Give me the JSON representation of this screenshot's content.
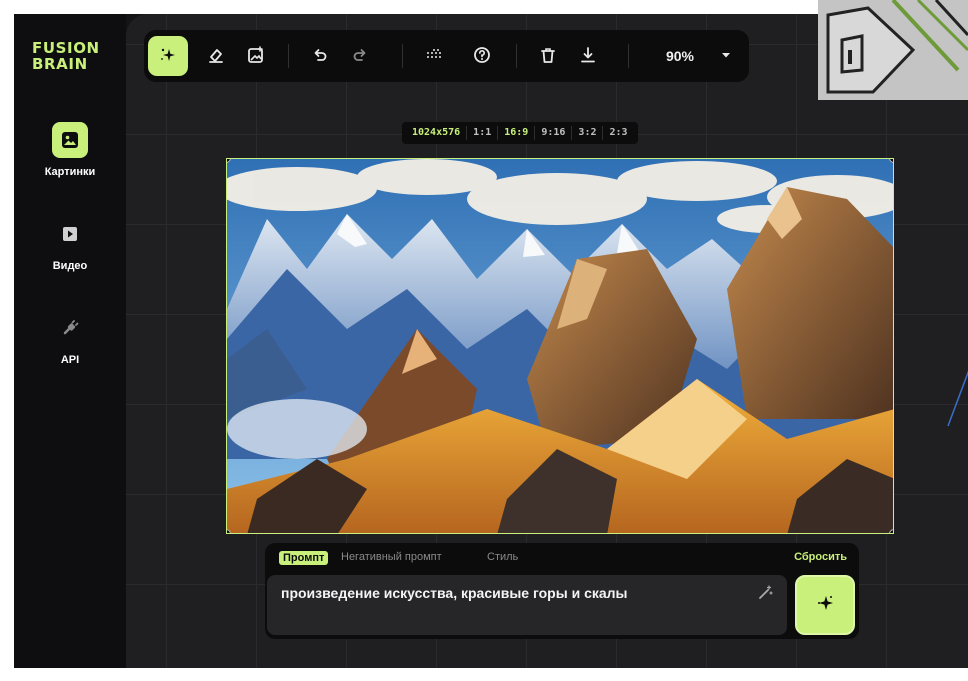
{
  "app": {
    "logo_line1": "FUSION",
    "logo_line2": "BRAIN"
  },
  "sidebar": {
    "items": [
      {
        "label": "Картинки",
        "icon": "image-icon",
        "active": true
      },
      {
        "label": "Видео",
        "icon": "play-icon",
        "active": false
      },
      {
        "label": "API",
        "icon": "plug-icon",
        "active": false
      }
    ]
  },
  "toolbar": {
    "tools": [
      "sparkle-icon",
      "eraser-icon",
      "image-add-icon",
      "undo-icon",
      "redo-icon",
      "grid-dots-icon",
      "help-icon",
      "trash-icon",
      "download-icon"
    ],
    "zoom": "90%",
    "zoom_dropdown_icon": "chevron-down-icon"
  },
  "aspect_bar": {
    "size": "1024x576",
    "ratios": [
      "1:1",
      "16:9",
      "9:16",
      "3:2",
      "2:3"
    ],
    "selected": "16:9"
  },
  "prompt_panel": {
    "tabs": [
      "Промпт",
      "Негативный промпт",
      "Стиль"
    ],
    "active_tab": "Промпт",
    "reset_label": "Сбросить",
    "prompt_text": "произведение искусства, красивые горы и скалы",
    "wand_icon": "magic-wand-icon",
    "generate_icon": "sparkle-icon"
  },
  "colors": {
    "accent": "#c8f07a",
    "background": "#1f1f21",
    "sidebar": "#0e0e10",
    "panel": "#0c0c0d"
  }
}
